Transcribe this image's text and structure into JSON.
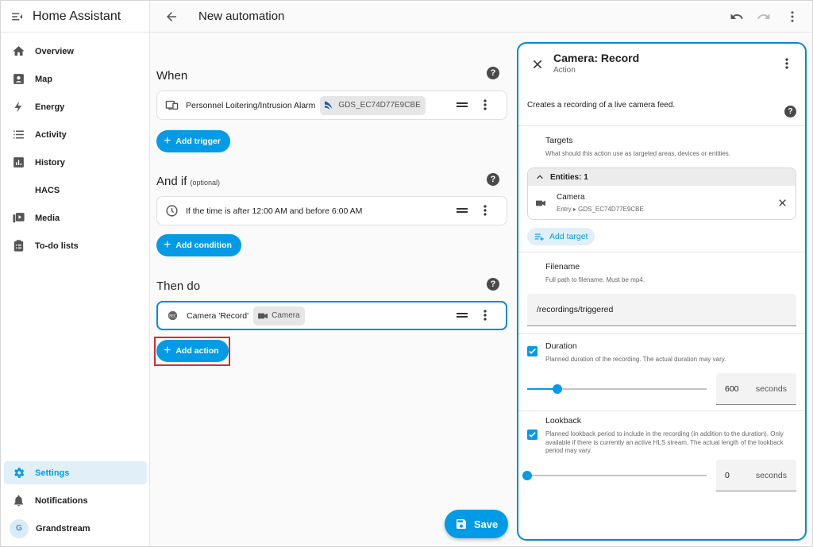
{
  "sidebar": {
    "title": "Home Assistant",
    "items": [
      {
        "label": "Overview",
        "icon": "home-icon"
      },
      {
        "label": "Map",
        "icon": "map-icon"
      },
      {
        "label": "Energy",
        "icon": "lightning-icon"
      },
      {
        "label": "Activity",
        "icon": "list-icon"
      },
      {
        "label": "History",
        "icon": "chart-icon"
      },
      {
        "label": "HACS",
        "icon": ""
      },
      {
        "label": "Media",
        "icon": "media-icon"
      },
      {
        "label": "To-do lists",
        "icon": "clipboard-icon"
      }
    ],
    "settings_label": "Settings",
    "notifications_label": "Notifications",
    "user_initial": "G",
    "user_name": "Grandstream"
  },
  "header": {
    "title": "New automation"
  },
  "when": {
    "title": "When",
    "trigger_text": "Personnel Loitering/Intrusion Alarm",
    "trigger_chip": "GDS_EC74D77E9CBE",
    "add_label": "Add trigger"
  },
  "and_if": {
    "title": "And if",
    "optional": "(optional)",
    "condition_text": "If the time is after 12:00 AM and before 6:00 AM",
    "add_label": "Add condition"
  },
  "then_do": {
    "title": "Then do",
    "action_text": "Camera 'Record'",
    "action_chip": "Camera",
    "add_label": "Add action"
  },
  "help_glyph": "?",
  "save_label": "Save",
  "panel": {
    "title": "Camera: Record",
    "subtitle": "Action",
    "description": "Creates a recording of a live camera feed.",
    "targets": {
      "label": "Targets",
      "help": "What should this action use as targeted areas, devices or entities.",
      "entities_header": "Entities: 1",
      "entity_name": "Camera",
      "entity_path": "Entry ▸ GDS_EC74D77E9CBE",
      "add_target_label": "Add target"
    },
    "filename": {
      "label": "Filename",
      "help": "Full path to filename. Must be mp4.",
      "value": "/recordings/triggered"
    },
    "duration": {
      "label": "Duration",
      "help": "Planned duration of the recording. The actual duration may vary.",
      "value": "600",
      "unit": "seconds",
      "slider_fraction": 0.17,
      "checked": true
    },
    "lookback": {
      "label": "Lookback",
      "help": "Planned lookback period to include in the recording (in addition to the duration). Only available if there is currently an active HLS stream. The actual length of the lookback period may vary.",
      "value": "0",
      "unit": "seconds",
      "slider_fraction": 0,
      "checked": true
    }
  },
  "colors": {
    "accent": "#039be5",
    "highlight": "#d32f2f"
  }
}
